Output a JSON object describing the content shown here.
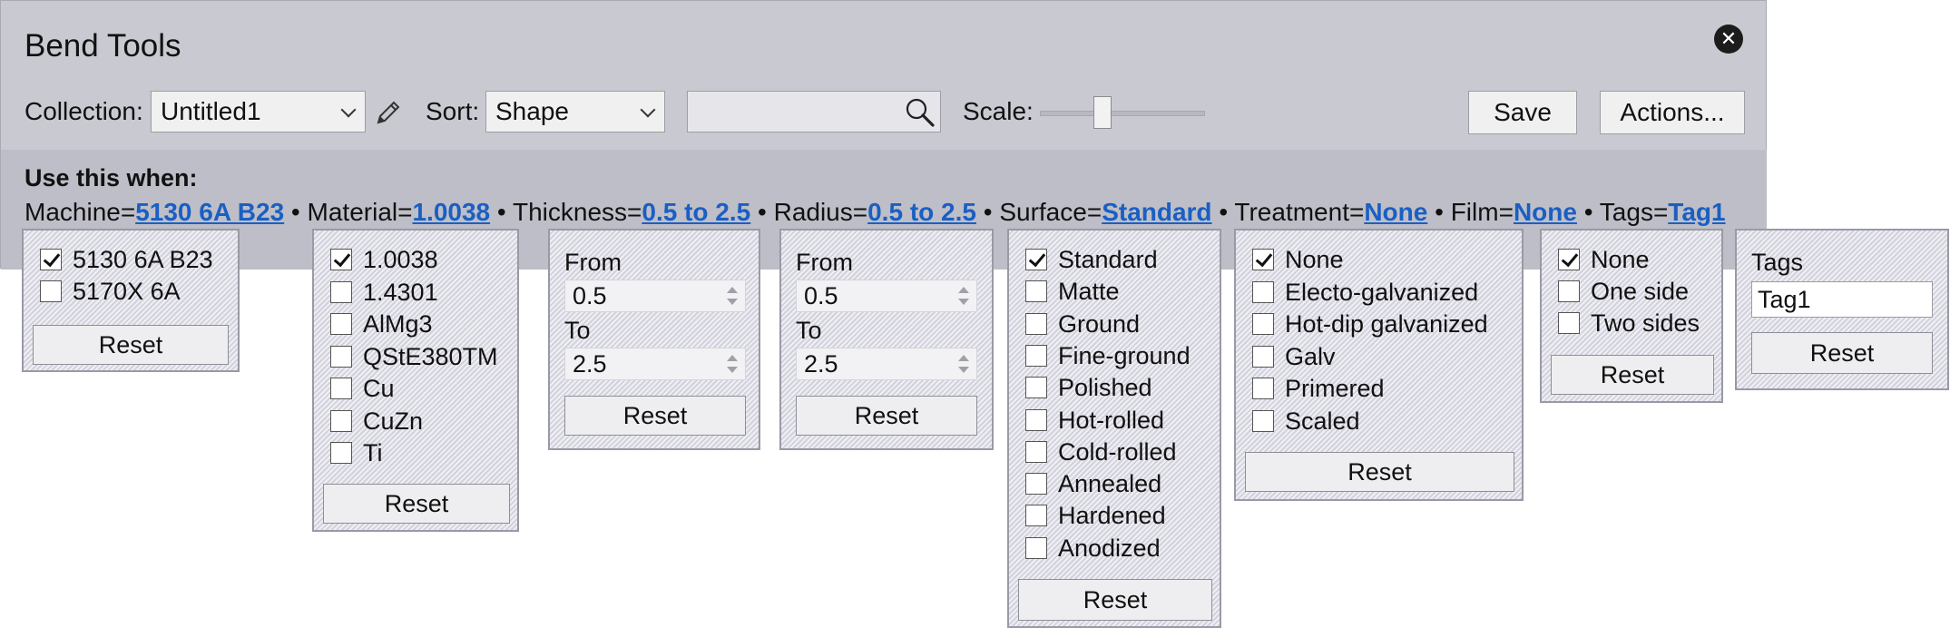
{
  "window": {
    "title": "Bend Tools"
  },
  "toolbar": {
    "collection_label": "Collection:",
    "collection_value": "Untitled1",
    "sort_label": "Sort:",
    "sort_value": "Shape",
    "search_value": "",
    "scale_label": "Scale:",
    "scale_level": 0.3,
    "save_label": "Save",
    "actions_label": "Actions..."
  },
  "conditions": {
    "heading": "Use this when:",
    "items": [
      {
        "key": "Machine=",
        "value": "5130 6A B23"
      },
      {
        "key": "Material=",
        "value": "1.0038"
      },
      {
        "key": "Thickness=",
        "value": "0.5 to 2.5"
      },
      {
        "key": "Radius=",
        "value": "0.5 to 2.5"
      },
      {
        "key": "Surface=",
        "value": "Standard"
      },
      {
        "key": "Treatment=",
        "value": "None"
      },
      {
        "key": "Film=",
        "value": "None"
      },
      {
        "key": "Tags=",
        "value": "Tag1"
      }
    ],
    "separator": " • "
  },
  "panels": {
    "machine": {
      "options": [
        {
          "label": "5130 6A B23",
          "checked": true
        },
        {
          "label": "5170X 6A",
          "checked": false
        }
      ],
      "reset": "Reset"
    },
    "material": {
      "options": [
        {
          "label": "1.0038",
          "checked": true
        },
        {
          "label": "1.4301",
          "checked": false
        },
        {
          "label": "AlMg3",
          "checked": false
        },
        {
          "label": "QStE380TM",
          "checked": false
        },
        {
          "label": "Cu",
          "checked": false
        },
        {
          "label": "CuZn",
          "checked": false
        },
        {
          "label": "Ti",
          "checked": false
        }
      ],
      "reset": "Reset"
    },
    "thickness": {
      "from_label": "From",
      "from_value": "0.5",
      "to_label": "To",
      "to_value": "2.5",
      "reset": "Reset"
    },
    "radius": {
      "from_label": "From",
      "from_value": "0.5",
      "to_label": "To",
      "to_value": "2.5",
      "reset": "Reset"
    },
    "surface": {
      "options": [
        {
          "label": "Standard",
          "checked": true
        },
        {
          "label": "Matte",
          "checked": false
        },
        {
          "label": "Ground",
          "checked": false
        },
        {
          "label": "Fine-ground",
          "checked": false
        },
        {
          "label": "Polished",
          "checked": false
        },
        {
          "label": "Hot-rolled",
          "checked": false
        },
        {
          "label": "Cold-rolled",
          "checked": false
        },
        {
          "label": "Annealed",
          "checked": false
        },
        {
          "label": "Hardened",
          "checked": false
        },
        {
          "label": "Anodized",
          "checked": false
        }
      ],
      "reset": "Reset"
    },
    "treatment": {
      "options": [
        {
          "label": "None",
          "checked": true
        },
        {
          "label": "Electo-galvanized",
          "checked": false
        },
        {
          "label": "Hot-dip galvanized",
          "checked": false
        },
        {
          "label": "Galv",
          "checked": false
        },
        {
          "label": "Primered",
          "checked": false
        },
        {
          "label": "Scaled",
          "checked": false
        }
      ],
      "reset": "Reset"
    },
    "film": {
      "options": [
        {
          "label": "None",
          "checked": true
        },
        {
          "label": "One side",
          "checked": false
        },
        {
          "label": "Two sides",
          "checked": false
        }
      ],
      "reset": "Reset"
    },
    "tags": {
      "label": "Tags",
      "value": "Tag1",
      "reset": "Reset"
    }
  },
  "icons": {
    "close": "close-icon",
    "edit": "pencil-icon",
    "search": "search-icon",
    "dropdown": "chevron-down-icon"
  },
  "colors": {
    "link": "#1a5fc2",
    "window_bg": "#c9c9d1",
    "panel_bg": "#dcdce6"
  }
}
